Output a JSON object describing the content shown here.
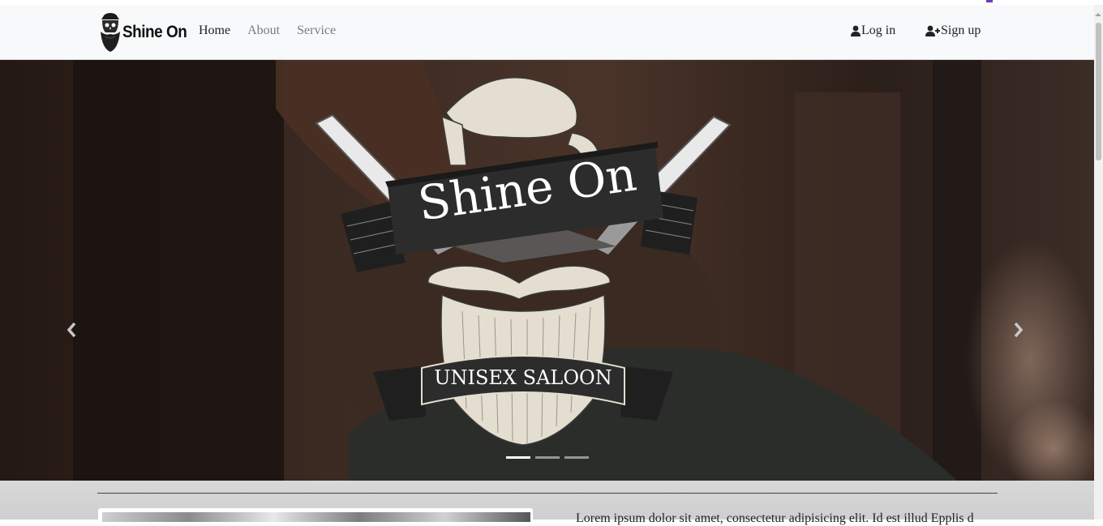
{
  "brand": {
    "name": "Shine On",
    "logo_icon": "bearded-skull-icon"
  },
  "nav": {
    "links": [
      {
        "label": "Home",
        "active": true
      },
      {
        "label": "About",
        "active": false
      },
      {
        "label": "Service",
        "active": false
      }
    ],
    "login": {
      "label": "Log in",
      "icon": "user-icon"
    },
    "signup": {
      "label": "Sign up",
      "icon": "user-plus-icon"
    }
  },
  "carousel": {
    "logo_title": "Shine On",
    "logo_subtitle": "UNISEX SALOON",
    "prev_icon": "chevron-left-icon",
    "next_icon": "chevron-right-icon",
    "slide_count": 3,
    "active_slide": 1
  },
  "below": {
    "text": "Lorem ipsum dolor sit amet, consectetur adipisicing elit. Id est illud Epplis d"
  },
  "colors": {
    "navbar_bg": "#f8f9fa",
    "carousel_bg": "#2a1c17",
    "logo_cream": "#e4ded0",
    "ribbon_dark": "#2c2c2c"
  }
}
